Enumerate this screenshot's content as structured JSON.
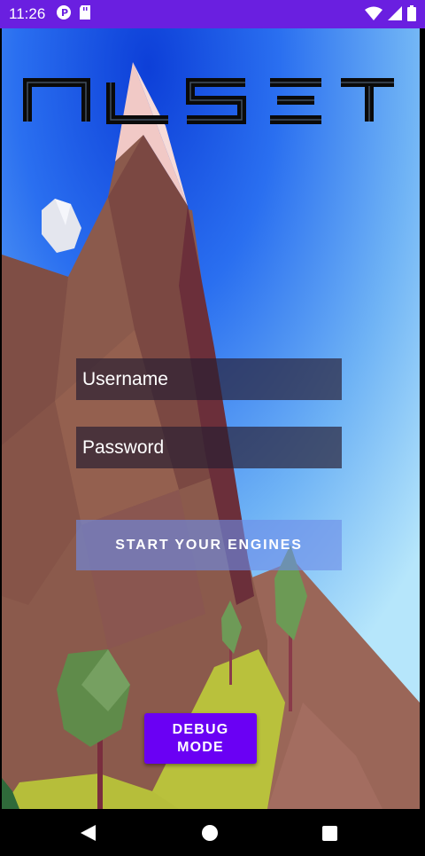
{
  "status_bar": {
    "time": "11:26",
    "left_icons": [
      "p-icon",
      "sd-card-icon"
    ],
    "right_icons": [
      "wifi-icon",
      "signal-icon",
      "battery-icon"
    ]
  },
  "app": {
    "logo_text": "ALSET"
  },
  "form": {
    "username_placeholder": "Username",
    "password_placeholder": "Password",
    "start_label": "START YOUR ENGINES"
  },
  "debug": {
    "label_line1": "DEBUG",
    "label_line2": "MODE"
  },
  "nav_bar": {
    "icons": [
      "back-icon",
      "home-icon",
      "recent-apps-icon"
    ]
  },
  "colors": {
    "status_bar": "#6a1fe0",
    "debug_button": "#6a00f4",
    "sky_top": "#2a6ff0",
    "sky_bottom": "#b6e6fb",
    "mountain": "#8b5a4c",
    "grass": "#b9c13c"
  }
}
